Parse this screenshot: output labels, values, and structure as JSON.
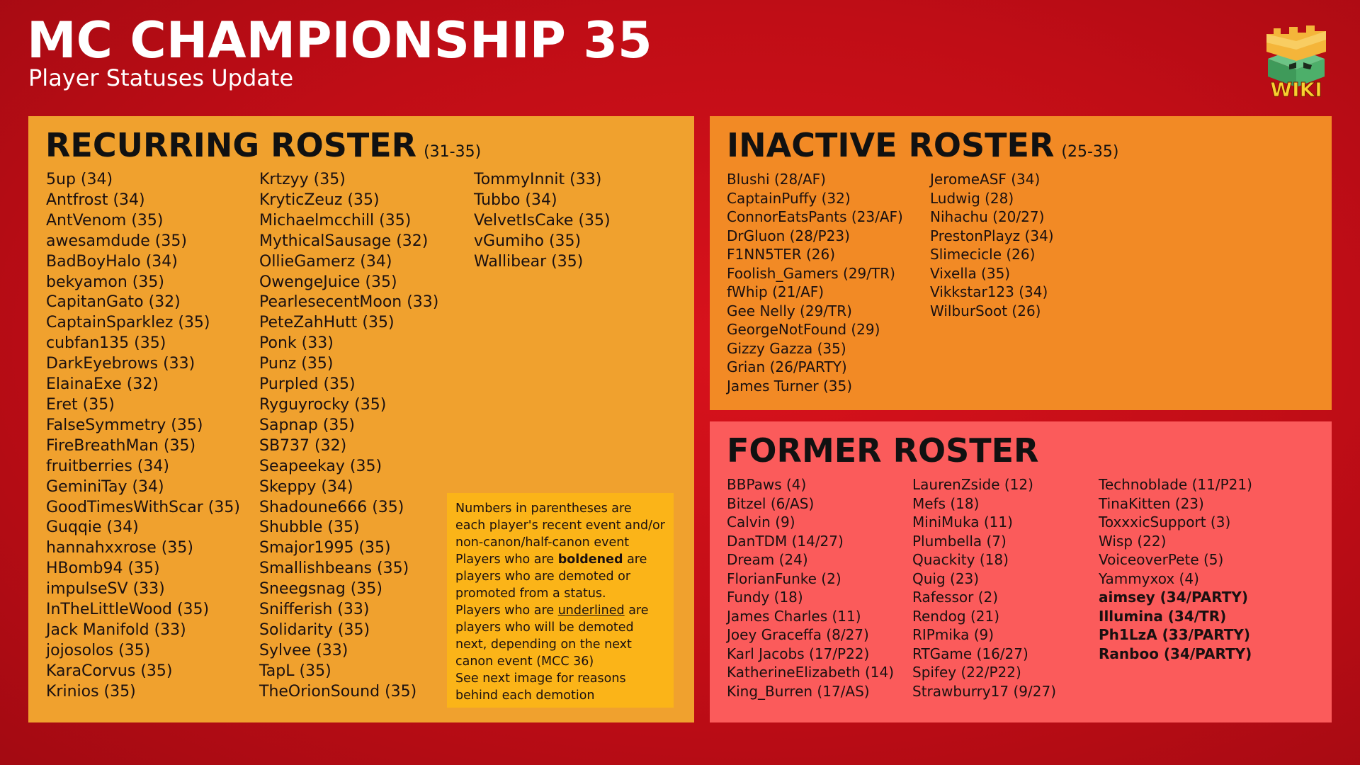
{
  "header": {
    "title": "MC CHAMPIONSHIP 35",
    "subtitle": "Player Statuses Update"
  },
  "logo": {
    "text": "WIKI",
    "icon": "castle-crown-cube-logo"
  },
  "colors": {
    "background": "#c00d16",
    "recurring": "#f0a12e",
    "inactive": "#f28a25",
    "former": "#fb5b5b",
    "note": "#fbb418"
  },
  "recurring": {
    "title": "RECURRING ROSTER",
    "range": "(31-35)",
    "columns": [
      [
        "5up (34)",
        "Antfrost (34)",
        "AntVenom (35)",
        "awesamdude (35)",
        "BadBoyHalo (34)",
        "bekyamon (35)",
        "CapitanGato (32)",
        "CaptainSparklez (35)",
        "cubfan135 (35)",
        "DarkEyebrows (33)",
        "ElainaExe (32)",
        "Eret (35)",
        "FalseSymmetry (35)",
        "FireBreathMan (35)",
        "fruitberries (34)",
        "GeminiTay (34)",
        "GoodTimesWithScar (35)",
        "Guqqie (34)",
        "hannahxxrose (35)",
        "HBomb94 (35)",
        "impulseSV (33)",
        "InTheLittleWood (35)",
        "Jack Manifold (33)",
        "jojosolos (35)",
        "KaraCorvus (35)",
        "Krinios (35)"
      ],
      [
        "Krtzyy (35)",
        "KryticZeuz (35)",
        "Michaelmcchill (35)",
        "MythicalSausage (32)",
        "OllieGamerz (34)",
        "OwengeJuice (35)",
        "PearlesecentMoon (33)",
        "PeteZahHutt (35)",
        "Ponk (33)",
        "Punz (35)",
        "Purpled (35)",
        "Ryguyrocky (35)",
        "Sapnap (35)",
        "SB737 (32)",
        "Seapeekay (35)",
        "Skeppy (34)",
        "Shadoune666 (35)",
        "Shubble (35)",
        "Smajor1995 (35)",
        "Smallishbeans (35)",
        "Sneegsnag (35)",
        "Snifferish (33)",
        "Solidarity (35)",
        "Sylvee (33)",
        "TapL (35)",
        "TheOrionSound (35)"
      ],
      [
        "TommyInnit (33)",
        "Tubbo (34)",
        "VelvetIsCake (35)",
        "vGumiho (35)",
        "Wallibear (35)"
      ]
    ],
    "note": {
      "line1": "Numbers in parentheses are each player's recent event and/or non-canon/half-canon event",
      "bold_prefix": "Players who are ",
      "bold_word": "boldened",
      "bold_suffix": " are players who are demoted or promoted from a status.",
      "under_prefix": "Players who are ",
      "under_word": "underlined",
      "under_suffix": " are players who will be demoted next, depending on the next canon event (MCC 36)",
      "line_last": "See next image for reasons behind each demotion"
    }
  },
  "inactive": {
    "title": "INACTIVE ROSTER",
    "range": "(25-35)",
    "columns": [
      [
        "Blushi (28/AF)",
        "CaptainPuffy (32)",
        "ConnorEatsPants (23/AF)",
        "DrGluon (28/P23)",
        "F1NN5TER (26)",
        "Foolish_Gamers (29/TR)",
        "fWhip (21/AF)",
        "Gee Nelly (29/TR)",
        "GeorgeNotFound (29)",
        "Gizzy Gazza (35)",
        "Grian (26/PARTY)",
        "James Turner (35)"
      ],
      [
        "JeromeASF (34)",
        "Ludwig (28)",
        "Nihachu (20/27)",
        "PrestonPlayz (34)",
        "Slimecicle (26)",
        "Vixella (35)",
        "Vikkstar123 (34)",
        "WilburSoot (26)"
      ]
    ]
  },
  "former": {
    "title": "FORMER ROSTER",
    "columns": [
      [
        "BBPaws (4)",
        "Bitzel (6/AS)",
        "Calvin (9)",
        "DanTDM (14/27)",
        "Dream (24)",
        "FlorianFunke (2)",
        "Fundy (18)",
        "James Charles (11)",
        "Joey Graceffa (8/27)",
        "Karl Jacobs (17/P22)",
        "KatherineElizabeth (14)",
        "King_Burren (17/AS)"
      ],
      [
        "LaurenZside (12)",
        "Mefs (18)",
        "MiniMuka (11)",
        "Plumbella (7)",
        "Quackity (18)",
        "Quig (23)",
        "Rafessor (2)",
        "Rendog (21)",
        "RIPmika (9)",
        "RTGame (16/27)",
        "Spifey (22/P22)",
        "Strawburry17 (9/27)"
      ],
      [
        "Technoblade (11/P21)",
        "TinaKitten (23)",
        "ToxxxicSupport (3)",
        "Wisp (22)",
        "VoiceoverPete (5)",
        "Yammyxox (4)",
        "aimsey (34/PARTY)",
        "Illumina (34/TR)",
        "Ph1LzA (33/PARTY)",
        "Ranboo (34/PARTY)"
      ]
    ],
    "bold": [
      "aimsey (34/PARTY)",
      "Illumina (34/TR)",
      "Ph1LzA (33/PARTY)",
      "Ranboo (34/PARTY)"
    ]
  }
}
